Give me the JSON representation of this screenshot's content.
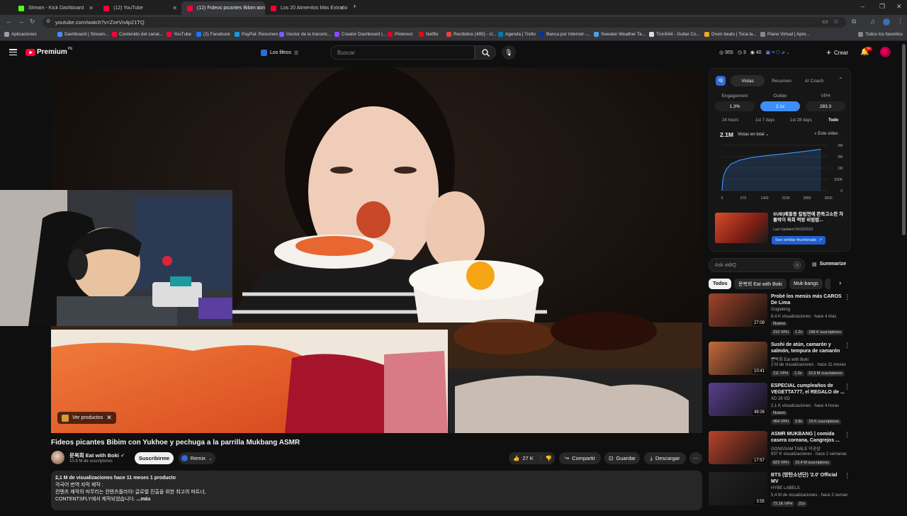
{
  "browser": {
    "tabs": [
      {
        "label": "Stream - Kick Dashboard",
        "favicon_color": "#53fc18"
      },
      {
        "label": "(12) YouTube",
        "favicon_color": "#ff0033"
      },
      {
        "label": "(12) Fideos picantes Bibim con",
        "favicon_color": "#ff0033"
      },
      {
        "label": "Los 20 Alimentos Más Extraño",
        "favicon_color": "#ff0033"
      }
    ],
    "url": "youtube.com/watch?v=ZxeVn4p21TQ",
    "bookmarks": [
      {
        "label": "Aplicaciones",
        "color": "#9aa0a6"
      },
      {
        "label": "Dashboard | Stream...",
        "color": "#4a8af4"
      },
      {
        "label": "Contenido del canal...",
        "color": "#ff0033"
      },
      {
        "label": "YouTube",
        "color": "#ff0033"
      },
      {
        "label": "(2) Facebook",
        "color": "#1877f2"
      },
      {
        "label": "PayPal: Resumen",
        "color": "#179bd7"
      },
      {
        "label": "Gestor de la transmi...",
        "color": "#7b5cff"
      },
      {
        "label": "Creator Dashboard |...",
        "color": "#9147ff"
      },
      {
        "label": "Pinterest",
        "color": "#e60023"
      },
      {
        "label": "Netflix",
        "color": "#e50914"
      },
      {
        "label": "Recibidos (495) - cl...",
        "color": "#ea4335"
      },
      {
        "label": "Agenda | Trello",
        "color": "#0079bf"
      },
      {
        "label": "Banca por Internet -...",
        "color": "#0033a0"
      },
      {
        "label": "Sweater Weather Ta...",
        "color": "#4aa3df"
      },
      {
        "label": "Tron544 - Guitar Co...",
        "color": "#dddddd"
      },
      {
        "label": "Drum beats | Toca la...",
        "color": "#f5a623"
      },
      {
        "label": "Piano Virtual | Apre...",
        "color": "#888888"
      }
    ],
    "all_bookmarks": "Todos los favoritos"
  },
  "youtube": {
    "logo": "Premium",
    "logo_super": "PE",
    "filters_label": "Los filtros",
    "search_placeholder": "Buscar",
    "header_stats": {
      "a": "955",
      "b": "3",
      "c": "40"
    },
    "create_label": "Crear",
    "notif_count": "9+"
  },
  "video": {
    "title": "Fideos picantes Bibim con Yukhoe y pechuga a la parrilla Mukbang ASMR",
    "products_label": "Ver productos",
    "channel": "문복희 Eat with Boki",
    "subs": "10,9 M de suscriptores",
    "subscribe_label": "Suscribirme",
    "remix_label": "Remix",
    "likes": "27 K",
    "share_label": "Compartir",
    "save_label": "Guardar",
    "download_label": "Descargar",
    "desc_meta": "2,1 M de visualizaciones  hace 11 meses  1 producto",
    "desc_line1": "각국어 번역 자막 제작 :",
    "desc_line2": "컨텐츠 제작의 마무리는 컨텐츠플라이! 글로벌 진출을 위한 최고의 파트너,",
    "desc_line3": "CONTENTSFLY에서 제작되었습니다. ",
    "desc_more": "...más"
  },
  "vidiq": {
    "tabs": [
      "Vistas",
      "Resumen",
      "AI Coach"
    ],
    "stats": [
      {
        "label": "Engagement",
        "value": "1.3%"
      },
      {
        "label": "Outlier",
        "value": "2.1x"
      },
      {
        "label": "VPH",
        "value": "283.3"
      }
    ],
    "ranges": [
      "24 hours",
      "1st 7 days",
      "1st 28 days",
      "Todo"
    ],
    "total_views": "2.1M",
    "views_select": "Vistas en total",
    "legend": "Este vídeo",
    "chart_data": {
      "type": "line",
      "title": "",
      "x_ticks": [
        "0",
        "670",
        "1400",
        "2100",
        "2800",
        "3600"
      ],
      "y_ticks": [
        "2M",
        "2M",
        "1M",
        "500K",
        "0"
      ],
      "series": [
        {
          "name": "Este vídeo",
          "x": [
            0,
            20,
            60,
            150,
            300,
            600,
            1000,
            1400,
            2100,
            2800,
            3350
          ],
          "y": [
            0,
            450000,
            800000,
            1100000,
            1350000,
            1550000,
            1680000,
            1760000,
            1870000,
            1990000,
            2100000
          ]
        }
      ],
      "xlim": [
        0,
        3600
      ],
      "ylim": [
        0,
        2300000
      ],
      "grid": true
    },
    "similar": {
      "title": "SUB)배홍동 칼빔면에 쫀득고소한 차돌박이 육회 먹방 비빔밥...",
      "updated": "Last Updated 04/22/2023",
      "button": "See similar thumbnails"
    },
    "ask_placeholder": "Ask vidIQ",
    "summarize_label": "Summarize"
  },
  "chips": [
    "Todos",
    "문복희 Eat with Boki",
    "Muk-bangs"
  ],
  "recommendations": [
    {
      "title": "Probé los menús más CAROS De Lima",
      "channel": "Gogioking",
      "meta": "8,4 K visualizaciones · hace 4 días",
      "badge": "Nuevo",
      "duration": "27:09",
      "tags": [
        "210 VPH",
        "1.2x",
        "168 K suscriptores"
      ],
      "thumb_color": "#a3442a"
    },
    {
      "title": "Sushi de atún, camarón y salmón, tempura de camarón ...",
      "channel": "문복희 Eat with Boki",
      "meta": "2 M de visualizaciones · hace 11 meses",
      "badge": "",
      "duration": "10:41",
      "tags": [
        "111 VPH",
        "1.0x",
        "10,9 M suscriptores"
      ],
      "thumb_color": "#c76a3c"
    },
    {
      "title": "ESPECIAL cumpleaños de VEGETTA777, el REGALO de ...",
      "channel": "XD 28 XD",
      "meta": "2,1 K visualizaciones · hace 4 horas",
      "badge": "Nuevo",
      "duration": "49:26",
      "tags": [
        "454 VPH",
        "3.8x",
        "19 K suscriptores"
      ],
      "thumb_color": "#5a3f8f"
    },
    {
      "title": "ASMR MUKBANG | comida casera coreana, Cangrejos ...",
      "channel": "GONGSAM TABLE 이공삼",
      "meta": "937 K visualizaciones · hace 2 semanas",
      "badge": "",
      "duration": "17:57",
      "tags": [
        "823 VPH",
        "",
        "15,4 M suscriptores"
      ],
      "thumb_color": "#b8432a"
    },
    {
      "title": "BTS (방탄소년단) '2.0' Official MV",
      "channel": "HYBE LABELS",
      "meta": "5,4 M de visualizaciones · hace 2 seman",
      "badge": "",
      "duration": "3:55",
      "tags": [
        "72.1K VPH",
        "21x",
        ""
      ],
      "thumb_color": "#222222"
    }
  ]
}
